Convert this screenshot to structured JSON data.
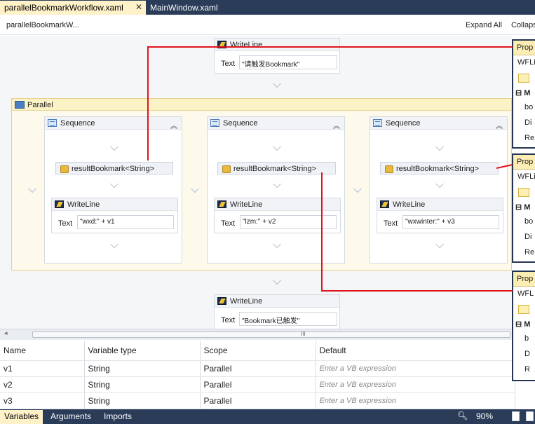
{
  "tabs": [
    {
      "label": "parallelBookmarkWorkflow.xaml",
      "active": true
    },
    {
      "label": "MainWindow.xaml",
      "active": false
    }
  ],
  "breadcrumb": "parallelBookmarkW...",
  "header_buttons": {
    "expand_all": "Expand All",
    "collapse_all": "Collapse All"
  },
  "top_writeline": {
    "title": "WriteLine",
    "text_label": "Text",
    "text_value": "\"请触发Bookmark\""
  },
  "parallel": {
    "title": "Parallel"
  },
  "sequences": [
    {
      "title": "Sequence",
      "bookmark": "resultBookmark<String>",
      "writeline_title": "WriteLine",
      "text_label": "Text",
      "text_value": "\"wxd:\" + v1"
    },
    {
      "title": "Sequence",
      "bookmark": "resultBookmark<String>",
      "writeline_title": "WriteLine",
      "text_label": "Text",
      "text_value": "\"lzm:\" + v2"
    },
    {
      "title": "Sequence",
      "bookmark": "resultBookmark<String>",
      "writeline_title": "WriteLine",
      "text_label": "Text",
      "text_value": "\"wxwinter:\" + v3"
    }
  ],
  "bottom_writeline": {
    "title": "WriteLine",
    "text_label": "Text",
    "text_value": "\"Bookmark已触发\""
  },
  "scrollbar_grip": "III",
  "variables": {
    "columns": [
      "Name",
      "Variable type",
      "Scope",
      "Default"
    ],
    "rows": [
      {
        "name": "v1",
        "type": "String",
        "scope": "Parallel",
        "default": "Enter a VB expression"
      },
      {
        "name": "v2",
        "type": "String",
        "scope": "Parallel",
        "default": "Enter a VB expression"
      },
      {
        "name": "v3",
        "type": "String",
        "scope": "Parallel",
        "default": "Enter a VB expression"
      }
    ]
  },
  "status_tabs": [
    "Variables",
    "Arguments",
    "Imports"
  ],
  "zoom": "90%",
  "property_panels": [
    {
      "header": "Prop",
      "name": "WFLi",
      "category": "M",
      "rows": [
        "bo",
        "Di",
        "Re"
      ]
    },
    {
      "header": "Prop",
      "name": "WFLi",
      "category": "M",
      "rows": [
        "bo",
        "Di",
        "Re"
      ]
    },
    {
      "header": "Prop",
      "name": "WFL",
      "category": "M",
      "rows": [
        "b",
        "D",
        "R"
      ]
    }
  ],
  "colors": {
    "link_line": "#e0141c",
    "chrome": "#2b3c59",
    "active_tab": "#fff1c8"
  }
}
